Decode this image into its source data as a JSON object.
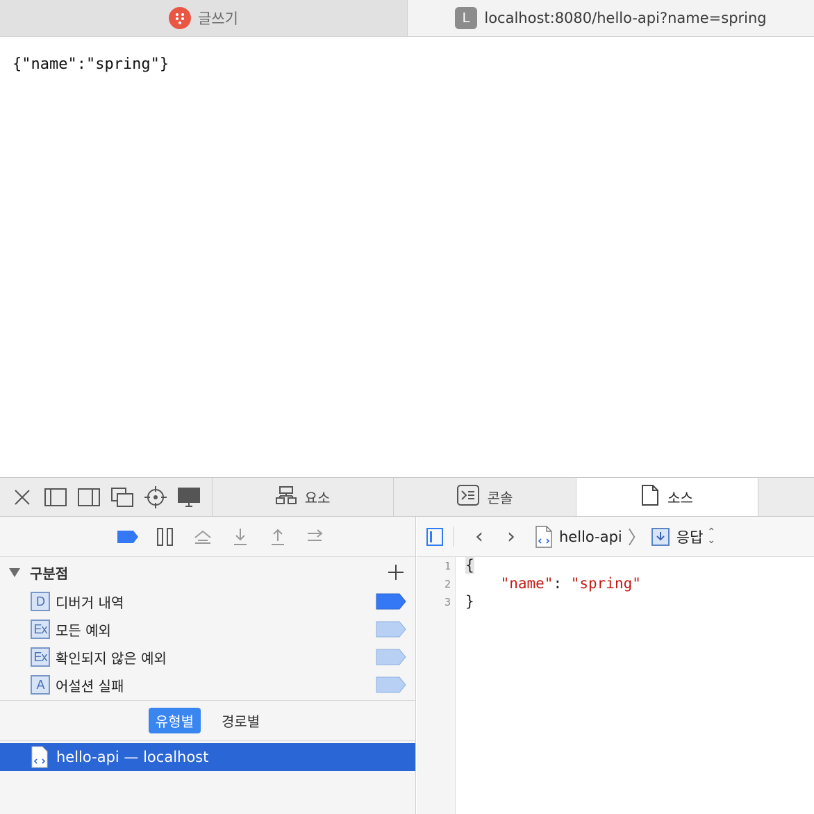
{
  "tabs": [
    {
      "title": "글쓰기",
      "favicon": "tistory-dots-icon",
      "color": "#ea5644"
    },
    {
      "title": "localhost:8080/hello-api?name=spring",
      "favicon_letter": "L"
    }
  ],
  "page": {
    "body_text": "{\"name\":\"spring\"}"
  },
  "devtools": {
    "tabs": {
      "elements": "요소",
      "console": "콘솔",
      "sources": "소스"
    },
    "breakpoints": {
      "title": "구분점",
      "items": [
        {
          "icon_letter": "D",
          "label": "디버거 내역",
          "enabled": true
        },
        {
          "icon_letter": "Ex",
          "label": "모든 예외",
          "enabled": false
        },
        {
          "icon_letter": "Ex",
          "label": "확인되지 않은 예외",
          "enabled": false
        },
        {
          "icon_letter": "A",
          "label": "어설션 실패",
          "enabled": false
        }
      ]
    },
    "scope": {
      "by_type": "유형별",
      "by_path": "경로별"
    },
    "resource": {
      "label": "hello-api — localhost"
    },
    "navigation": {
      "file": "hello-api",
      "response": "응답"
    },
    "editor": {
      "lines": [
        {
          "num": "1",
          "text": "{"
        },
        {
          "num": "2",
          "key": "\"name\"",
          "colon": ": ",
          "value": "\"spring\""
        },
        {
          "num": "3",
          "text": "}"
        }
      ]
    },
    "colors": {
      "accent": "#2b66d6",
      "active_flag": "#3478f6",
      "inactive_flag": "#b7d0f4",
      "string": "#c41a16"
    }
  }
}
